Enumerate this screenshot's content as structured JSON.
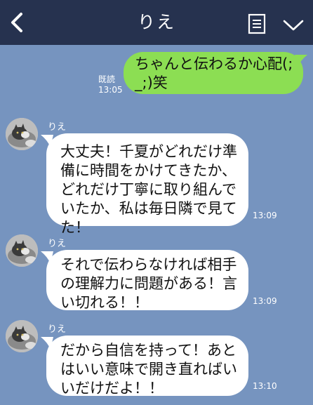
{
  "header": {
    "title": "りえ",
    "back_icon": "chevron-left-icon",
    "menu_icon": "list-icon",
    "expand_icon": "chevron-down-icon",
    "background": "#26324f"
  },
  "chat_background": "#7694bf",
  "messages": [
    {
      "direction": "outgoing",
      "lines": [
        "ちゃんと伝わるか心配(;",
        "_;)笑"
      ],
      "read_label": "既読",
      "time": "13:05",
      "bubble_color": "#8cde53"
    },
    {
      "direction": "incoming",
      "sender": "りえ",
      "lines": [
        "大丈夫！千夏がどれだけ準",
        "備に時間をかけてきたか、",
        "どれだけ丁寧に取り組んで",
        "いたか、私は毎日隣で見て",
        "た！"
      ],
      "time": "13:09"
    },
    {
      "direction": "incoming",
      "sender": "りえ",
      "lines": [
        "それで伝わらなければ相手",
        "の理解力に問題がある！言",
        "い切れる！！"
      ],
      "time": "13:09"
    },
    {
      "direction": "incoming",
      "sender": "りえ",
      "lines": [
        "だから自信を持って！あと",
        "はいい意味で開き直ればい",
        "いだけだよ！！"
      ],
      "time": "13:10"
    }
  ]
}
